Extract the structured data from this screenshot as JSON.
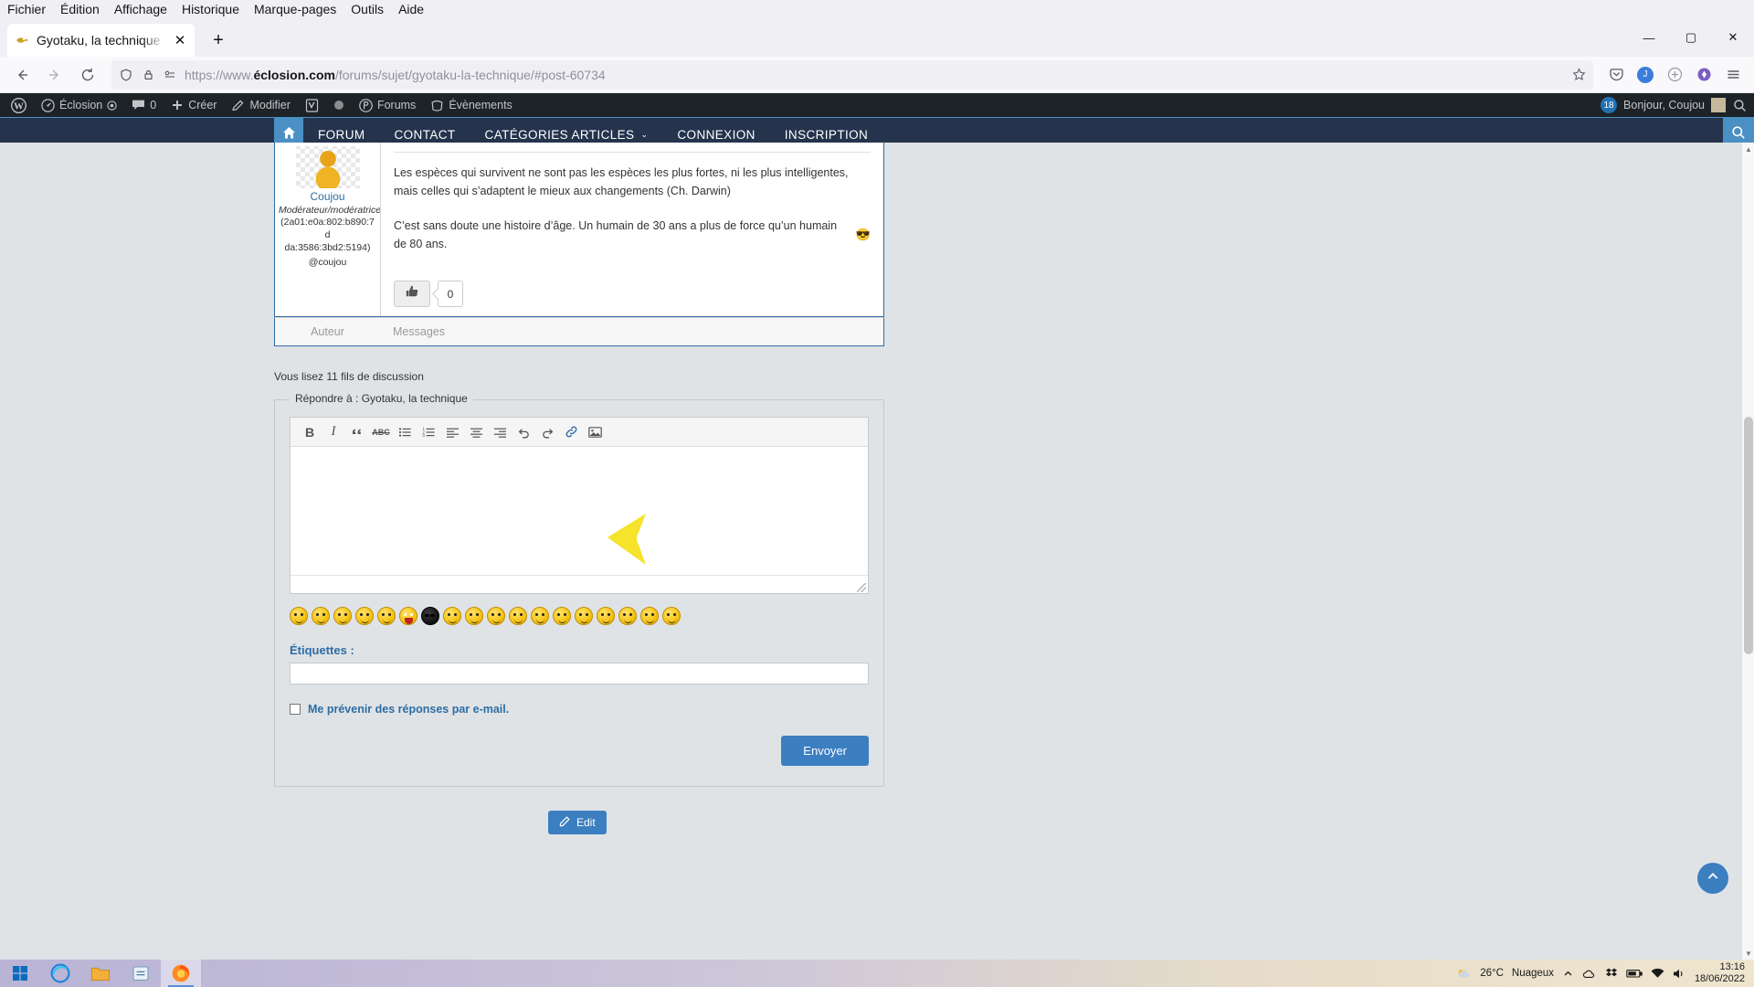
{
  "browser": {
    "menu": [
      "Fichier",
      "Édition",
      "Affichage",
      "Historique",
      "Marque-pages",
      "Outils",
      "Aide"
    ],
    "tab": {
      "title": "Gyotaku, la technique - Éclosion",
      "close": "✕",
      "favicon_name": "fish-favicon"
    },
    "newtab_label": "+",
    "window_controls": {
      "minimize": "—",
      "maximize": "▢",
      "close": "✕"
    },
    "url": {
      "scheme": "https://www.",
      "domain": "éclosion.com",
      "path": "/forums/sujet/gyotaku-la-technique/#post-60734"
    },
    "nav": {
      "back": "←",
      "forward": "→",
      "reload": "⟳"
    },
    "account_initial": "J"
  },
  "adminbar": {
    "items": [
      {
        "icon": "wordpress-icon",
        "label": ""
      },
      {
        "icon": "dashboard-icon",
        "label": "Éclosion"
      },
      {
        "icon": "comment-icon",
        "label": "0"
      },
      {
        "icon": "plus-icon",
        "label": "Créer"
      },
      {
        "icon": "pencil-icon",
        "label": "Modifier"
      },
      {
        "icon": "yoast-icon",
        "label": ""
      },
      {
        "icon": "buddypress-icon",
        "label": "Forums"
      },
      {
        "icon": "events-icon",
        "label": "Évènements"
      }
    ],
    "notification_count": "18",
    "greeting": "Bonjour, Coujou",
    "search_icon": "search-icon"
  },
  "sitenav": {
    "home_icon": "home-icon",
    "links": [
      "FORUM",
      "CONTACT",
      "CATÉGORIES ARTICLES",
      "CONNEXION",
      "INSCRIPTION"
    ],
    "dropdown_caret": "⌄",
    "search_icon": "search-icon",
    "accent": "#4a90c4",
    "background": "#25334d"
  },
  "post": {
    "author_name": "Coujou",
    "author_role": "Modérateur/modératrice",
    "author_ip_line1": "(2a01:e0a:802:b890:7d",
    "author_ip_line2": "da:3586:3bd2:5194)",
    "author_handle": "@coujou",
    "paragraph1": "Les espèces qui survivent ne sont pas les espèces les plus fortes, ni les plus intelligentes, mais celles qui s’adaptent le mieux aux changements (Ch. Darwin)",
    "paragraph2": "C’est sans doute une histoire d’âge. Un humain de 30 ans a plus de force qu’un humain de 80 ans.",
    "paragraph2_emoji": "😎",
    "like_icon": "thumbs-up-icon",
    "like_count": "0",
    "footer_col1": "Auteur",
    "footer_col2": "Messages"
  },
  "thread": {
    "count_text": "Vous lisez 11 fils de discussion"
  },
  "reply": {
    "legend": "Répondre à : Gyotaku, la technique",
    "toolbar": [
      {
        "name": "bold-button",
        "label": "B"
      },
      {
        "name": "italic-button",
        "label": "I"
      },
      {
        "name": "blockquote-button",
        "label": "❝"
      },
      {
        "name": "strikethrough-button",
        "label": "ABC"
      },
      {
        "name": "bullet-list-button",
        "label": "•≡"
      },
      {
        "name": "numbered-list-button",
        "label": "1≡"
      },
      {
        "name": "align-left-button",
        "label": "≡"
      },
      {
        "name": "align-center-button",
        "label": "≡"
      },
      {
        "name": "align-right-button",
        "label": "≡"
      },
      {
        "name": "undo-button",
        "label": "↶"
      },
      {
        "name": "redo-button",
        "label": "↷"
      },
      {
        "name": "link-button",
        "label": "🔗"
      },
      {
        "name": "insert-image-button",
        "label": "🖼"
      }
    ],
    "editor_value": "",
    "smilies_count": 18,
    "tags_label": "Étiquettes :",
    "tags_value": "",
    "notify_label": "Me prévenir des réponses par e-mail.",
    "notify_checked": false,
    "submit_label": "Envoyer"
  },
  "edit_button": {
    "label": "Edit",
    "icon": "edit-icon"
  },
  "scroll_top": {
    "icon": "chevron-up-icon"
  },
  "taskbar": {
    "start_icon": "windows-start-icon",
    "apps": [
      "edge-icon",
      "file-explorer-icon",
      "store-icon",
      "firefox-icon"
    ],
    "weather_temp": "26°C",
    "weather_desc": "Nuageux",
    "tray_icons": [
      "chevron-up-icon",
      "onedrive-icon",
      "dropbox-icon",
      "battery-icon",
      "network-icon",
      "volume-icon"
    ],
    "time": "13:16",
    "date": "18/06/2022"
  }
}
